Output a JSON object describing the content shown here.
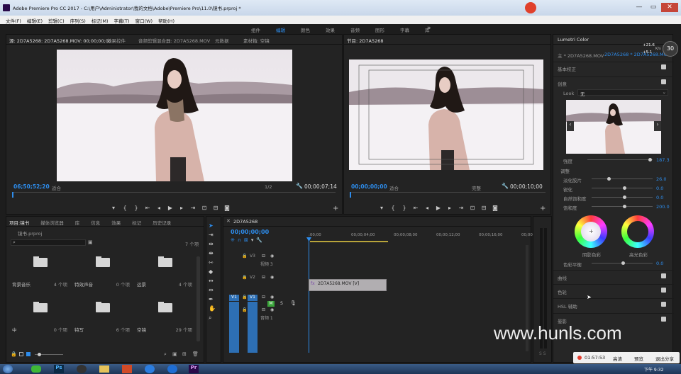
{
  "window": {
    "title": "Adobe Premiere Pro CC 2017 - C:\\用户\\Administrator\\我的文档\\Adobe\\Premiere Pro\\11.0\\镜书.prproj *"
  },
  "menu": [
    "文件(F)",
    "编辑(E)",
    "剪辑(C)",
    "序列(S)",
    "标记(M)",
    "字幕(T)",
    "窗口(W)",
    "帮助(H)"
  ],
  "workspaces": [
    {
      "label": "组件",
      "active": false
    },
    {
      "label": "编辑",
      "active": true
    },
    {
      "label": "颜色",
      "active": false
    },
    {
      "label": "效果",
      "active": false
    },
    {
      "label": "音频",
      "active": false
    },
    {
      "label": "图形",
      "active": false
    },
    {
      "label": "字幕",
      "active": false
    },
    {
      "label": "库",
      "active": false
    }
  ],
  "workspace_more": "»",
  "source_monitor": {
    "tabs": [
      "源: 2D7A5268: 2D7A5268.MOV: 00;00;00;00",
      "效果控件",
      "音频剪辑混合器: 2D7A5268.MOV",
      "元数据",
      "素材箱: 空镜"
    ],
    "timecode": "06;50;52;20",
    "fit": "适合",
    "ratio": "1/2",
    "duration": "00;00;07;14"
  },
  "program_monitor": {
    "tab": "节目: 2D7A5268",
    "timecode": "00;00;00;00",
    "fit": "适合",
    "quality": "完整",
    "duration": "00;00;10;00"
  },
  "transport_icons": [
    "marker-in-icon",
    "mark-in-icon",
    "mark-out-icon",
    "go-to-in-icon",
    "step-back-icon",
    "play-icon",
    "step-forward-icon",
    "go-to-out-icon",
    "insert-icon",
    "overwrite-icon",
    "export-frame-icon"
  ],
  "project_panel": {
    "tabs": [
      "项目:镜书",
      "媒体浏览器",
      "库",
      "信息",
      "效果",
      "标记",
      "历史记录"
    ],
    "file": "镜书.prproj",
    "count": "7 个项",
    "bins": [
      {
        "name": "背景音乐",
        "count": "4 个项"
      },
      {
        "name": "特效声音",
        "count": "0 个项"
      },
      {
        "name": "远景",
        "count": "4 个项"
      },
      {
        "name": "中",
        "count": "0 个项"
      },
      {
        "name": "特写",
        "count": "6 个项"
      },
      {
        "name": "空镜",
        "count": "29 个项"
      }
    ]
  },
  "timeline": {
    "tab": "2D7A5268",
    "timecode": "00;00;00;00",
    "ruler": [
      ";00;00",
      "00;00;04;00",
      "00;00;08;00",
      "00;00;12;00",
      "00;00;16;00",
      "00;00;20"
    ],
    "tracks": [
      {
        "src": "",
        "tgt": "V3",
        "name": "视频 3"
      },
      {
        "src": "",
        "tgt": "V2",
        "name": ""
      },
      {
        "src": "V1",
        "tgt": "V1",
        "name": ""
      },
      {
        "src": "A1",
        "tgt": "A1",
        "name": "音频 1"
      }
    ],
    "clip": "2D7A5268.MOV [V]",
    "mute": "M",
    "solo": "S"
  },
  "lumetri": {
    "title": "Lumetri Color",
    "source": "主 * 2D7A5268.MOV",
    "sequence": "2D7A5268 * 2D7A5268.MOV",
    "sections": {
      "basic": "基本校正",
      "creative": "创意",
      "curves": "曲线",
      "wheels": "色轮",
      "hsl": "HSL 辅助",
      "vignette": "晕影"
    },
    "look_label": "Look",
    "look_value": "无",
    "intensity_label": "强度",
    "intensity_value": "187.3",
    "adjust": "调整",
    "sliders": [
      {
        "label": "淡化胶片",
        "value": "26.0"
      },
      {
        "label": "锐化",
        "value": "0.0"
      },
      {
        "label": "自然饱和度",
        "value": "0.0"
      },
      {
        "label": "饱和度",
        "value": "200.0"
      }
    ],
    "shadow_label": "阴影色彩",
    "highlight_label": "高光色彩",
    "balance_label": "色彩平衡",
    "balance_value": "0.0",
    "net_up": "+21.6",
    "net_down": "+5.1",
    "net_unit": "K/s",
    "cpu": "30"
  },
  "watermark": "www.hunls.com",
  "recorder": {
    "time": "01:57:53",
    "buttons": [
      "高清",
      "预览",
      "退出分享"
    ]
  },
  "clock": "下午 9:32",
  "taskbar": [
    "Ps",
    "Pr"
  ],
  "colors": {
    "accent": "#2d8ceb",
    "panel": "#232323",
    "bg": "#1d1d1d"
  }
}
